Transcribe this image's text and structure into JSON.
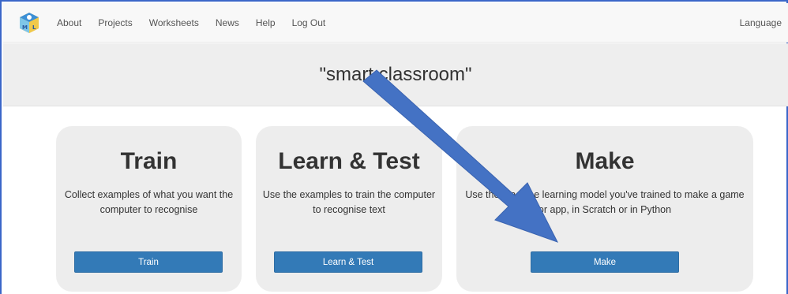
{
  "nav": {
    "items": [
      "About",
      "Projects",
      "Worksheets",
      "News",
      "Help",
      "Log Out"
    ],
    "language_label": "Language"
  },
  "banner": {
    "title": "\"smart classroom\""
  },
  "cards": [
    {
      "title": "Train",
      "description": "Collect examples of what you want the computer to recognise",
      "button_label": "Train"
    },
    {
      "title": "Learn & Test",
      "description": "Use the examples to train the computer to recognise text",
      "button_label": "Learn & Test"
    },
    {
      "title": "Make",
      "description": "Use the machine learning model you've trained to make a game or app, in Scratch or in Python",
      "button_label": "Make"
    }
  ],
  "colors": {
    "primary_button": "#337ab7",
    "annotation_arrow": "#4472c4",
    "frame_border": "#3a66c8"
  },
  "icons": {
    "logo": "ml4k-logo-icon",
    "annotation": "arrow-annotation-icon"
  }
}
